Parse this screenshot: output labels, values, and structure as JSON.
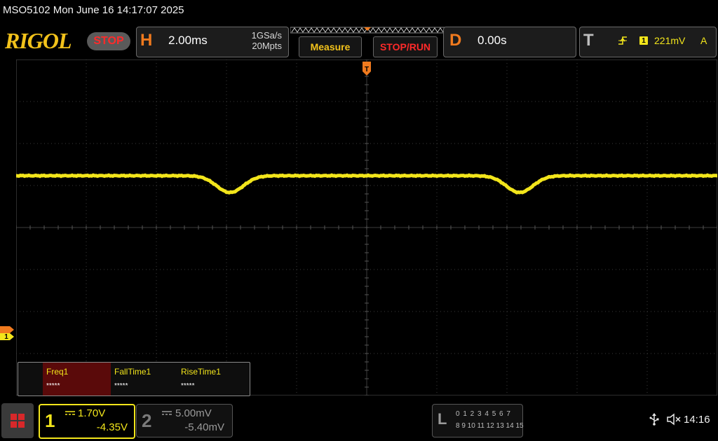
{
  "status_line": "MSO5102  Mon June 16 14:17:07 2025",
  "brand": {
    "logo": "RIGOL",
    "run_state": "STOP"
  },
  "horizontal": {
    "label": "H",
    "timebase": "2.00ms",
    "sample_rate": "1GSa/s",
    "memory_depth": "20Mpts"
  },
  "buttons": {
    "measure": "Measure",
    "stop_run": "STOP/RUN"
  },
  "delay": {
    "label": "D",
    "value": "0.00s"
  },
  "trigger": {
    "label": "T",
    "source": "1",
    "level": "221mV",
    "mode": "A",
    "edge_icon": "rising-edge-icon"
  },
  "measurements": [
    {
      "name": "Freq1",
      "value": "*****",
      "highlighted": true
    },
    {
      "name": "FallTime1",
      "value": "*****",
      "highlighted": false
    },
    {
      "name": "RiseTime1",
      "value": "*****",
      "highlighted": false
    }
  ],
  "channel1": {
    "number": "1",
    "scale": "1.70V",
    "offset": "-4.35V",
    "color": "#f2e51b",
    "marker_label": "1"
  },
  "channel2": {
    "number": "2",
    "scale": "5.00mV",
    "offset": "-5.40mV",
    "color": "#9a9a9a"
  },
  "logic": {
    "label": "L",
    "row1": "0 1 2 3  4 5 6 7",
    "row2": "8 9 10 11 12 13 14 15"
  },
  "system": {
    "clock": "14:16",
    "usb_icon": "usb-icon",
    "speaker_icon": "speaker-muted-icon"
  },
  "colors": {
    "trace": "#f2e51b",
    "accent_orange": "#f07a1e",
    "stop_red": "#ff2a2a",
    "grid": "#3c3c3c"
  }
}
